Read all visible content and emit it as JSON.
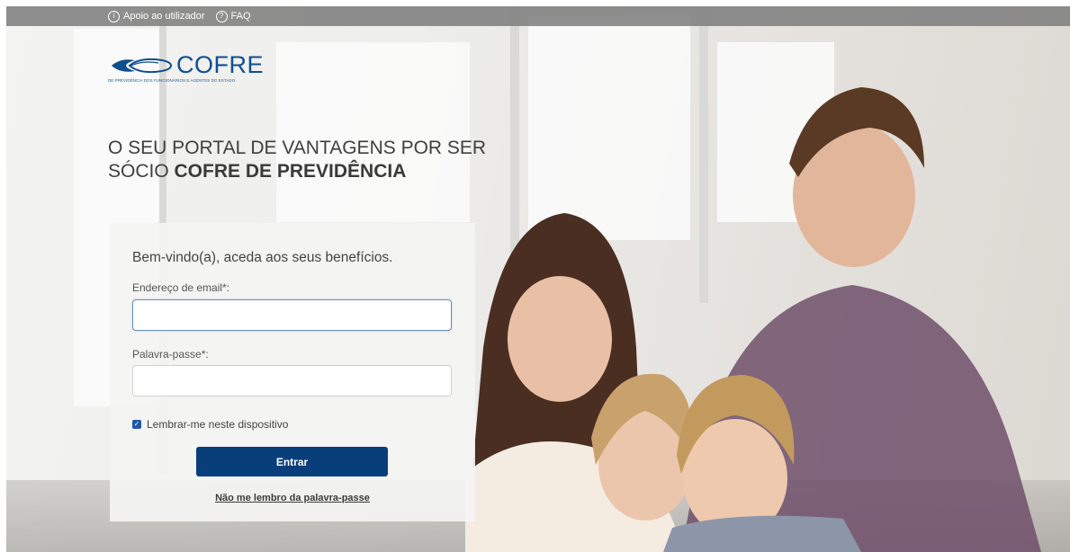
{
  "topbar": {
    "support_icon": "info-circle-icon",
    "support_label": "Apoio ao utilizador",
    "faq_icon": "question-circle-icon",
    "faq_label": "FAQ"
  },
  "logo": {
    "name": "COFRE",
    "subtitle": "DE PREVIDÊNCIA DOS FUNCIONÁRIOS E AGENTES DO ESTADO"
  },
  "headline": {
    "normal": "O SEU PORTAL DE VANTAGENS POR SER SÓCIO ",
    "bold": "COFRE DE PREVIDÊNCIA"
  },
  "login": {
    "welcome": "Bem-vindo(a), aceda aos seus benefícios.",
    "email_label": "Endereço de email*:",
    "email_value": "",
    "password_label": "Palavra-passe*:",
    "password_value": "",
    "remember_label": "Lembrar-me neste dispositivo",
    "remember_checked": true,
    "submit_label": "Entrar",
    "forgot_label": "Não me lembro da palavra-passe"
  },
  "colors": {
    "brand": "#083f7a",
    "logo_blue": "#0f4f8f",
    "topbar": "#808080"
  }
}
